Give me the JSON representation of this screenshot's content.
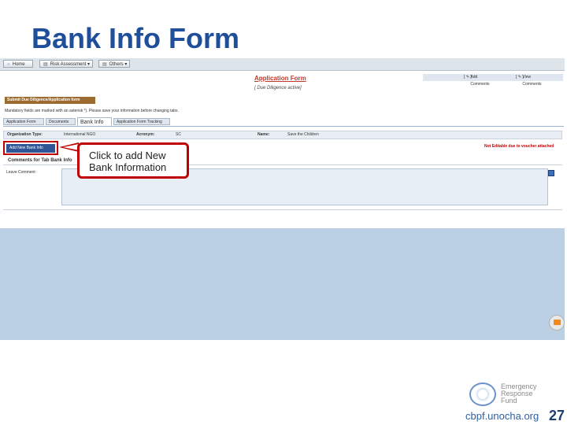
{
  "slide": {
    "title": "Bank Info Form",
    "page_number": "27",
    "footer_url": "cbpf.unocha.org",
    "logo_lines": [
      "Emergency",
      "Response",
      "Fund"
    ]
  },
  "app": {
    "nav": {
      "home": "Home",
      "risk": "Risk Assessment",
      "others": "Others"
    },
    "form_title": "Application Form",
    "form_subtitle": "[ Due Diligence active]",
    "add_comments": "Add Comments",
    "view_comments": "View Comments",
    "submit_button": "Submit Due Diligence/Application form",
    "mandatory_note": "Mandatory fields are marked with an asterisk *). Please save your information before changing tabs.",
    "tabs": [
      "Application Form",
      "Documents",
      "Bank Info",
      "Application Form Tracking"
    ],
    "active_tab": "Bank Info",
    "org_type_label": "Organization Type:",
    "org_type_value": "International NGO",
    "acronym_label": "Acronym:",
    "acronym_value": "SC",
    "name_label": "Name:",
    "name_value": "Save the Children",
    "add_bank_button": "Add New Bank Info",
    "not_editable": "Not Editable due to voucher attached",
    "comments_heading": "Comments for Tab Bank Info",
    "leave_comment_label": "Leave Comment:"
  },
  "callout": {
    "line1": "Click to add New",
    "line2": "Bank Information"
  },
  "colors": {
    "title": "#1f4e9a",
    "callout_border": "#c00000",
    "add_button": "#2f5597",
    "submit_button": "#9c6b2f",
    "background_panel": "#bcd0e3"
  }
}
